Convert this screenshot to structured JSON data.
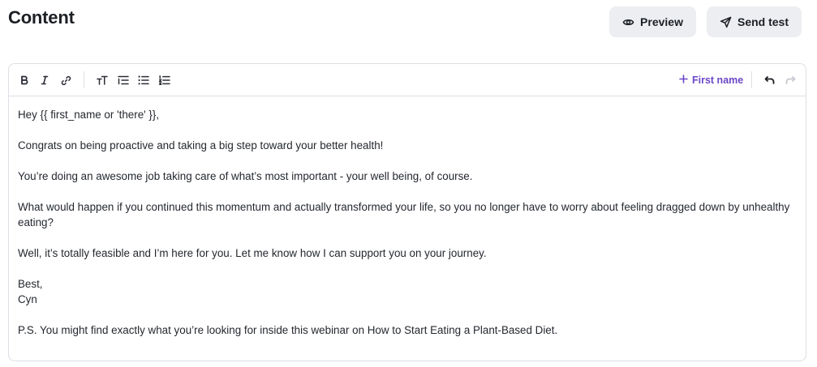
{
  "header": {
    "title": "Content",
    "preview_label": "Preview",
    "send_test_label": "Send test"
  },
  "toolbar": {
    "tools": [
      "bold-icon",
      "italic-icon",
      "link-icon",
      "text-size-icon",
      "indent-list-icon",
      "bullet-list-icon",
      "numbered-list-icon",
      "undo-icon",
      "redo-icon"
    ],
    "first_name_label": "First name",
    "accent_color": "#6b47c7",
    "redo_disabled": true
  },
  "editor": {
    "line1": "Hey {{ first_name or 'there' }},",
    "line2": "Congrats on being proactive and taking a big step toward your better health!",
    "line3": "You’re doing an awesome job taking care of what’s most important - your well being, of course.",
    "line4": "What would happen if you continued this momentum and actually transformed your life, so you no longer have to worry about feeling dragged down by unhealthy eating?",
    "line5": "Well, it’s totally feasible and I’m here for you. Let me know how I can support you on your journey.",
    "signoff": "Best,",
    "signature": "Cyn",
    "ps": "P.S. You might find exactly what you’re looking for inside this webinar on How to Start Eating a Plant-Based Diet."
  }
}
